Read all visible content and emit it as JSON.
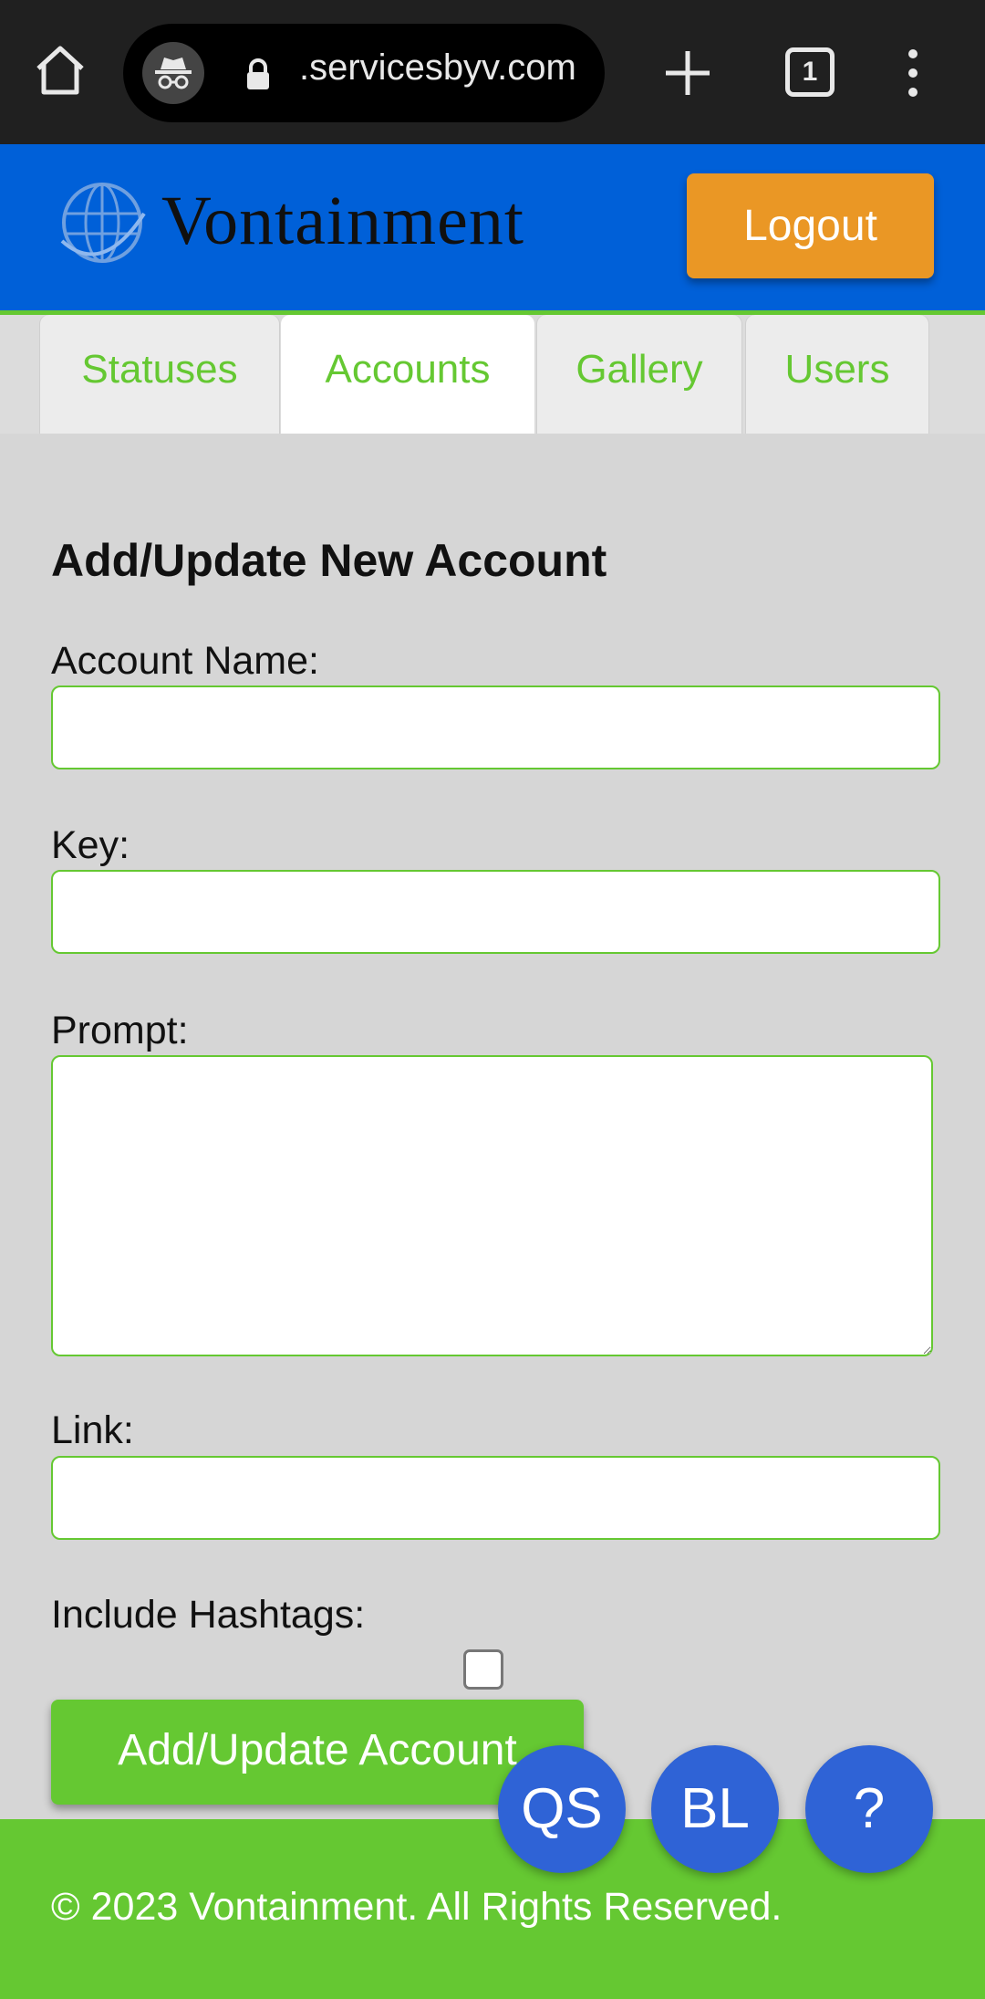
{
  "browser": {
    "url": ".servicesbyv.com",
    "tab_count": "1",
    "icons": [
      "home-icon",
      "incognito-icon",
      "lock-icon",
      "plus-icon",
      "tabs-icon",
      "more-vert-icon"
    ]
  },
  "header": {
    "logo_text": "Vontainment",
    "logout_label": "Logout",
    "brand_blue": "#0060d8",
    "accent_orange": "#ea9725"
  },
  "tabs": [
    {
      "label": "Statuses",
      "active": false
    },
    {
      "label": "Accounts",
      "active": true
    },
    {
      "label": "Gallery",
      "active": false
    },
    {
      "label": "Users",
      "active": false
    }
  ],
  "form": {
    "title": "Add/Update New Account",
    "account_name_label": "Account Name:",
    "account_name_value": "",
    "key_label": "Key:",
    "key_value": "",
    "prompt_label": "Prompt:",
    "prompt_value": "",
    "link_label": "Link:",
    "link_value": "",
    "hashtags_label": "Include Hashtags:",
    "hashtags_checked": false,
    "submit_label": "Add/Update Account"
  },
  "footer": {
    "text": "© 2023 Vontainment. All Rights Reserved.",
    "green": "#65c832"
  },
  "fabs": [
    {
      "label": "QS"
    },
    {
      "label": "BL"
    },
    {
      "label": "?"
    }
  ]
}
